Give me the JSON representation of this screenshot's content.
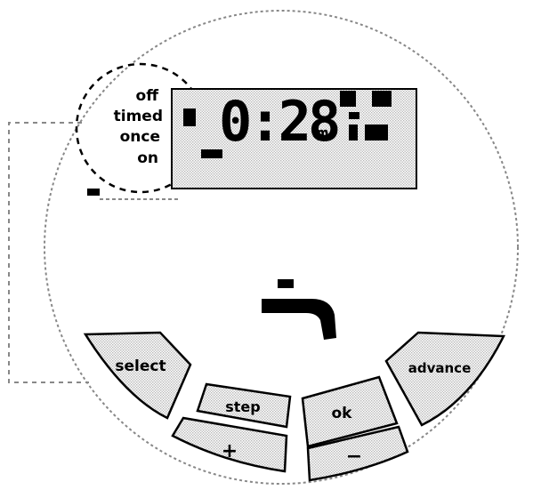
{
  "mode_selector": {
    "options": [
      "off",
      "timed",
      "once",
      "on"
    ],
    "selected": "timed"
  },
  "display": {
    "time": "0:28",
    "suffix": "m"
  },
  "buttons": {
    "select": "select",
    "step": "step",
    "plus": "+",
    "ok": "ok",
    "minus": "−",
    "advance": "advance"
  },
  "colors": {
    "outline": "#000000",
    "panel_fill": "#dcdcdc",
    "dashed": "#808080"
  }
}
